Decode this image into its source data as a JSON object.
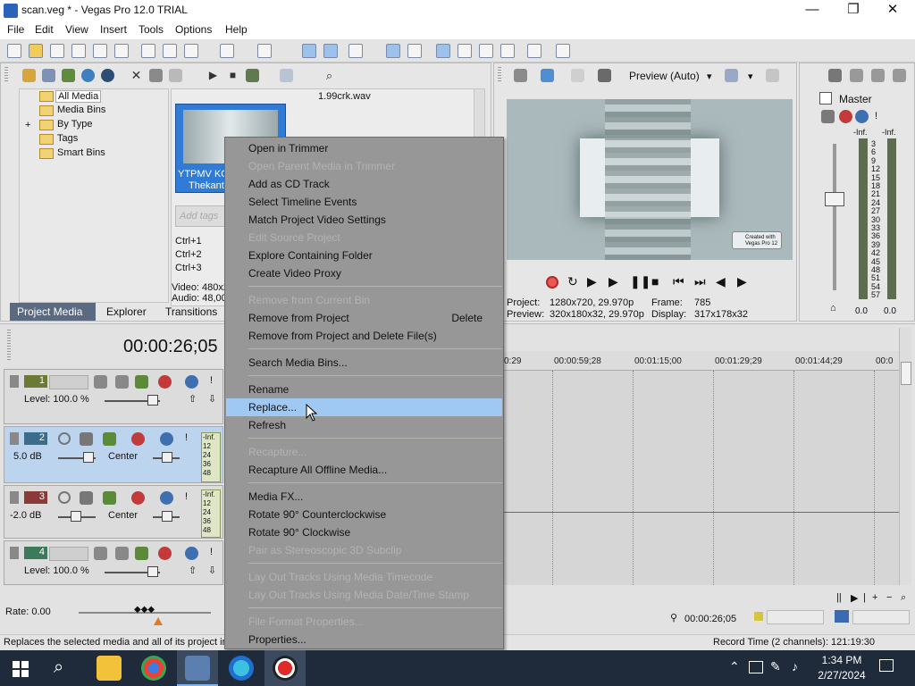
{
  "app": {
    "title": "scan.veg * - Vegas Pro 12.0 TRIAL"
  },
  "menu": [
    "File",
    "Edit",
    "View",
    "Insert",
    "Tools",
    "Options",
    "Help"
  ],
  "project_media": {
    "tree": [
      "All Media",
      "Media Bins",
      "By Type",
      "Tags",
      "Smart Bins"
    ],
    "tree_expander": "+",
    "file_top": "1.99crk.wav",
    "thumb_caption_1": "YTPMV KCB",
    "thumb_caption_2": "Thekanta",
    "add_tags_placeholder": "Add tags",
    "shortcuts": [
      "Ctrl+1",
      "Ctrl+2",
      "Ctrl+3"
    ],
    "video_info": "Video: 480x2",
    "audio_info": "Audio: 48,00",
    "tabs": [
      "Project Media",
      "Explorer",
      "Transitions"
    ]
  },
  "preview": {
    "mode": "Preview (Auto)",
    "project_label": "Project:",
    "project_value": "1280x720, 29.970p",
    "preview_label": "Preview:",
    "preview_value": "320x180x32, 29.970p",
    "frame_label": "Frame:",
    "frame_value": "785",
    "display_label": "Display:",
    "display_value": "317x178x32",
    "watermark_line1": "Created with",
    "watermark_line2": "Vegas Pro 12"
  },
  "master": {
    "label": "Master",
    "inf_left": "-Inf.",
    "inf_right": "-Inf.",
    "scale": [
      "3",
      "6",
      "9",
      "12",
      "15",
      "18",
      "21",
      "24",
      "27",
      "30",
      "33",
      "36",
      "39",
      "42",
      "45",
      "48",
      "51",
      "54",
      "57"
    ],
    "bottom_left": "0.0",
    "bottom_right": "0.0"
  },
  "timeline": {
    "timecode": "00:00:26;05",
    "ruler": [
      "0:29",
      "00:00:59;28",
      "00:01:15;00",
      "00:01:29;29",
      "00:01:44;29",
      "00:0"
    ],
    "tracks": [
      {
        "num": "1",
        "level": "Level: 100.0 %"
      },
      {
        "num": "2",
        "level": "5.0 dB",
        "pan": "Center",
        "meter_top": "-Inf.",
        "meter_vals": [
          "12",
          "24",
          "36",
          "48"
        ]
      },
      {
        "num": "3",
        "level": "-2.0 dB",
        "pan": "Center",
        "meter_top": "-Inf.",
        "meter_vals": [
          "12",
          "24",
          "36",
          "48"
        ]
      },
      {
        "num": "4",
        "level": "Level: 100.0 %"
      }
    ],
    "rate": "Rate: 0.00",
    "cursor_time": "00:00:26;05"
  },
  "context_menu": {
    "items": [
      {
        "label": "Open in Trimmer",
        "enabled": true
      },
      {
        "label": "Open Parent Media in Trimmer",
        "enabled": false
      },
      {
        "label": "Add as CD Track",
        "enabled": true
      },
      {
        "label": "Select Timeline Events",
        "enabled": true
      },
      {
        "label": "Match Project Video Settings",
        "enabled": true
      },
      {
        "label": "Edit Source Project",
        "enabled": false
      },
      {
        "label": "Explore Containing Folder",
        "enabled": true
      },
      {
        "label": "Create Video Proxy",
        "enabled": true
      },
      {
        "label": "Remove from Current Bin",
        "enabled": false
      },
      {
        "label": "Remove from Project",
        "enabled": true,
        "shortcut": "Delete"
      },
      {
        "label": "Remove from Project and Delete File(s)",
        "enabled": true
      },
      {
        "label": "Search Media Bins...",
        "enabled": true
      },
      {
        "label": "Rename",
        "enabled": true
      },
      {
        "label": "Replace...",
        "enabled": true,
        "highlighted": true
      },
      {
        "label": "Refresh",
        "enabled": true
      },
      {
        "label": "Recapture...",
        "enabled": false
      },
      {
        "label": "Recapture All Offline Media...",
        "enabled": true
      },
      {
        "label": "Media FX...",
        "enabled": true
      },
      {
        "label": "Rotate 90° Counterclockwise",
        "enabled": true
      },
      {
        "label": "Rotate 90° Clockwise",
        "enabled": true
      },
      {
        "label": "Pair as Stereoscopic 3D Subclip",
        "enabled": false
      },
      {
        "label": "Lay Out Tracks Using Media Timecode",
        "enabled": false
      },
      {
        "label": "Lay Out Tracks Using Media Date/Time Stamp",
        "enabled": false
      },
      {
        "label": "File Format Properties...",
        "enabled": false
      },
      {
        "label": "Properties...",
        "enabled": true
      }
    ]
  },
  "status": {
    "hint": "Replaces the selected media and all of its project ins",
    "record_time": "Record Time (2 channels): 121:19:30"
  },
  "taskbar": {
    "time": "1:34 PM",
    "date": "2/27/2024"
  },
  "colors": {
    "menu_bg": "#979797",
    "menu_highlight": "#9fc8f2",
    "selection_blue": "#2f7bd6",
    "taskbar": "#1f2a3a"
  }
}
